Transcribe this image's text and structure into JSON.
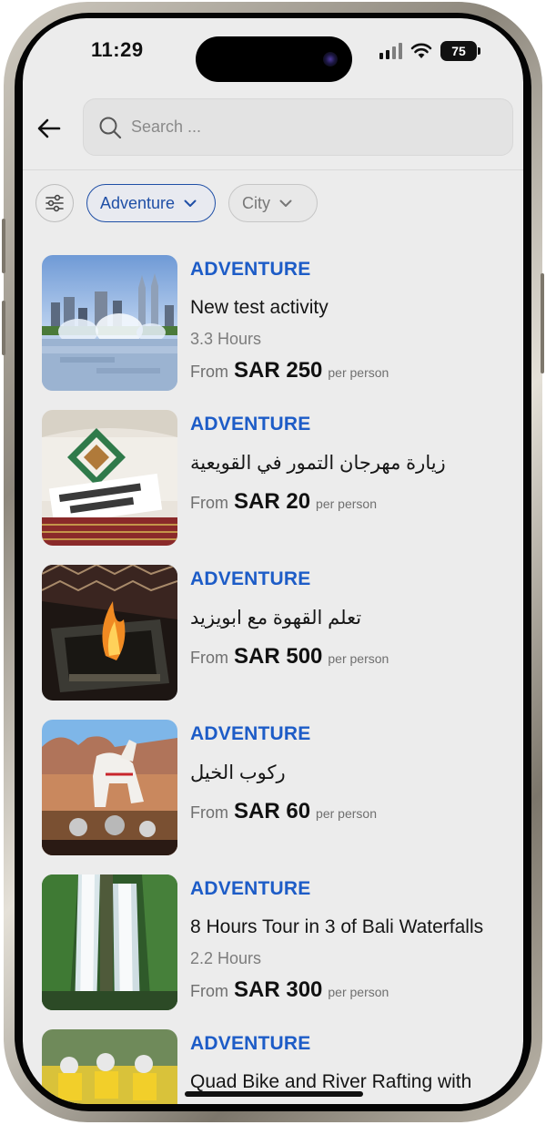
{
  "status_bar": {
    "time": "11:29",
    "battery": "75"
  },
  "search": {
    "placeholder": "Search ..."
  },
  "filters": {
    "category": "Adventure",
    "city": "City"
  },
  "activities": [
    {
      "category": "ADVENTURE",
      "title": "New test activity",
      "duration": "3.3 Hours",
      "from": "From",
      "price": "SAR 250",
      "per": "per person"
    },
    {
      "category": "ADVENTURE",
      "title": "زيارة مهرجان التمور في القويعية",
      "duration": "",
      "from": "From",
      "price": "SAR 20",
      "per": "per person"
    },
    {
      "category": "ADVENTURE",
      "title": "تعلم القهوة مع ابويزيد",
      "duration": "",
      "from": "From",
      "price": "SAR 500",
      "per": "per person"
    },
    {
      "category": "ADVENTURE",
      "title": "ركوب الخيل",
      "duration": "",
      "from": "From",
      "price": "SAR 60",
      "per": "per person"
    },
    {
      "category": "ADVENTURE",
      "title": "8 Hours Tour in 3 of Bali Waterfalls",
      "duration": "2.2 Hours",
      "from": "From",
      "price": "SAR 300",
      "per": "per person"
    },
    {
      "category": "ADVENTURE",
      "title": "Quad Bike and River Rafting with"
    }
  ],
  "colors": {
    "accent": "#1d5cc7",
    "chip_border": "#1f4fa6",
    "background": "#ececec"
  },
  "icons": [
    "back-arrow-icon",
    "search-icon",
    "filter-sliders-icon",
    "chevron-down-icon",
    "signal-icon",
    "wifi-icon",
    "battery-icon"
  ]
}
